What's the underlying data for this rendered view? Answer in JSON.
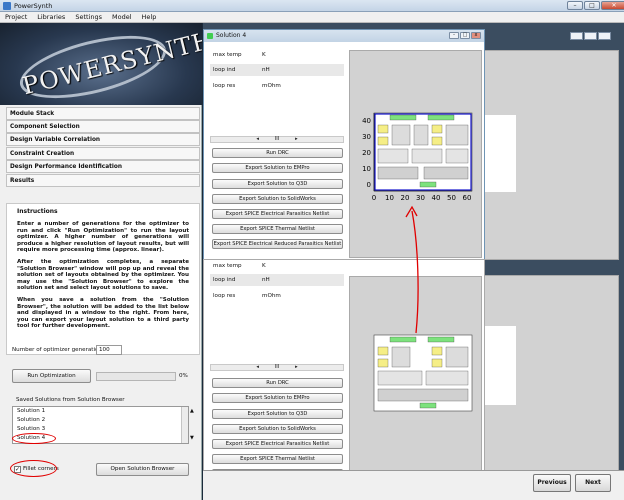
{
  "window": {
    "title": "PowerSynth"
  },
  "menu": [
    "Project",
    "Libraries",
    "Settings",
    "Model",
    "Help"
  ],
  "logo": {
    "text": "POWERSYNTH"
  },
  "sections": [
    "Module Stack",
    "Component Selection",
    "Design Variable Correlation",
    "Constraint Creation",
    "Design Performance Identification",
    "Results"
  ],
  "instructions": {
    "heading": "Instructions",
    "p1": "Enter a number of generations for the optimizer to run and click \"Run Optimization\" to run the layout optimizer. A higher number of generations will produce a higher resolution of layout results, but will require more processing time (approx. linear).",
    "p2": "After the optimization completes, a separate \"Solution Browser\" window will pop up and reveal the solution set of layouts obtained by the optimizer. You may use the \"Solution Browser\" to explore the solution set and select layout solutions to save.",
    "p3": "When you save a solution from the \"Solution Browser\", the solution will be added to the list below and displayed in a window to the right. From here, you can export your layout solution to a third party tool for further development."
  },
  "optimizer": {
    "label": "Number of optimizer generations:",
    "value": "100",
    "run_label": "Run Optimization",
    "progress_text": "0%",
    "progress": 0
  },
  "saved": {
    "label": "Saved Solutions from Solution Browser",
    "items": [
      "Solution 1",
      "Solution 2",
      "Solution 3",
      "Solution 4"
    ],
    "selected": "Solution 4"
  },
  "fillet": {
    "label": "Fillet corners",
    "checked": true
  },
  "open_browser_label": "Open Solution Browser",
  "solution_window": {
    "title": "Solution 4"
  },
  "props": [
    {
      "name": "max temp",
      "unit": "K"
    },
    {
      "name": "loop ind",
      "unit": "nH"
    },
    {
      "name": "loop res",
      "unit": "mOhm"
    }
  ],
  "actions": [
    "Run DRC",
    "Export Solution to EMPro",
    "Export Solution to Q3D",
    "Export Solution to SolidWorks",
    "Export SPICE Electrical Parasitics Netlist",
    "Export SPICE Thermal Netlist",
    "Export SPICE Electrical Reduced Parasitics Netlist"
  ],
  "plot": {
    "yticks": [
      "40",
      "30",
      "20",
      "10",
      "0"
    ],
    "xticks": [
      "0",
      "10",
      "20",
      "30",
      "40",
      "50",
      "60"
    ]
  },
  "nav": {
    "previous": "Previous",
    "next": "Next"
  },
  "colors": {
    "annotation": "#e00000",
    "pad": "#7de27d",
    "die": "#f5ee86",
    "trace": "#0000c8"
  }
}
